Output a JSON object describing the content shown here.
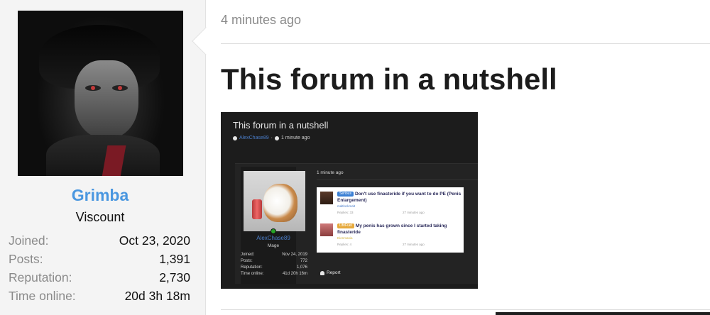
{
  "user": {
    "name": "Grimba",
    "title": "Viscount",
    "stats": [
      {
        "label": "Joined:",
        "value": "Oct 23, 2020"
      },
      {
        "label": "Posts:",
        "value": "1,391"
      },
      {
        "label": "Reputation:",
        "value": "2,730"
      },
      {
        "label": "Time online:",
        "value": "20d 3h 18m"
      }
    ]
  },
  "post": {
    "time": "4 minutes ago",
    "title": "This forum in a nutshell"
  },
  "embedded_screenshot": {
    "title": "This forum in a nutshell",
    "author": "AlexChase89",
    "separator": "·",
    "time": "1 minute ago",
    "post_time": "1 minute ago",
    "user": {
      "name": "AlexChase89",
      "rank": "Mage",
      "stats": [
        {
          "label": "Joined:",
          "value": "Nov 24, 2019"
        },
        {
          "label": "Posts:",
          "value": "772"
        },
        {
          "label": "Reputation:",
          "value": "1,076"
        },
        {
          "label": "Time online:",
          "value": "41d 20h 16m"
        }
      ]
    },
    "threads": [
      {
        "badge": "Serious",
        "title": "Don't use finasteride if you want to do PE (Penis Enlargement)",
        "author": "maltlockmalt",
        "replies": "Replies: 33",
        "ago": "27 minutes ago"
      },
      {
        "badge": "LifeFuel",
        "title": "My penis has grown since I started taking finasteride",
        "author": "Dienmania",
        "replies": "Replies: 4",
        "ago": "27 minutes ago"
      }
    ],
    "report": "Report"
  },
  "colors": {
    "username": "#4a97e0",
    "link_blue": "#4a7dc9",
    "sidebar_bg": "#f4f4f4",
    "embed_bg": "#1c1c1c"
  }
}
